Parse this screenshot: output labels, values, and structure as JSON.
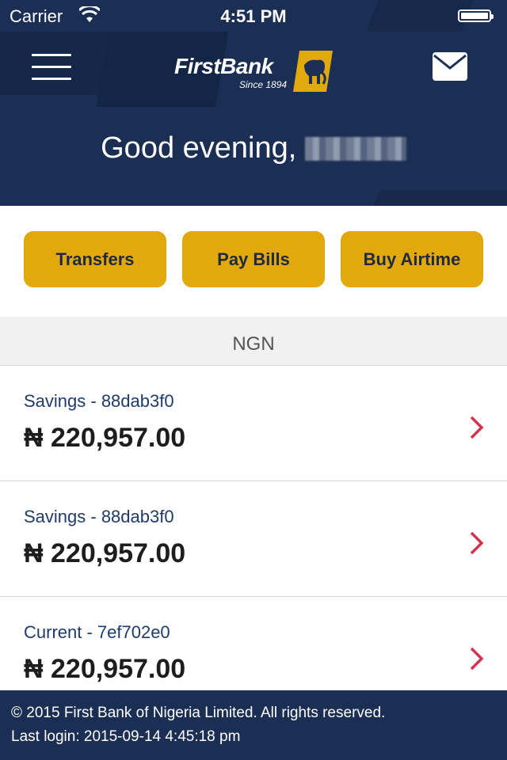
{
  "status_bar": {
    "carrier": "Carrier",
    "time": "4:51 PM",
    "wifi_icon": "wifi-icon",
    "battery_level": 1.0
  },
  "header": {
    "menu_icon": "hamburger-menu-icon",
    "logo": {
      "name": "FirstBank",
      "since": "Since 1894",
      "mark_icon": "elephant-logo-icon"
    },
    "mail_icon": "envelope-icon",
    "greeting": "Good evening,",
    "background_color": "#1b2f54"
  },
  "actions": [
    {
      "label": "Transfers"
    },
    {
      "label": "Pay Bills"
    },
    {
      "label": "Buy Airtime"
    }
  ],
  "currency": "NGN",
  "accounts": [
    {
      "label": "Savings - 88dab3f0",
      "balance": "₦ 220,957.00"
    },
    {
      "label": "Savings - 88dab3f0",
      "balance": "₦ 220,957.00"
    },
    {
      "label": "Current - 7ef702e0",
      "balance": "₦ 220,957.00"
    }
  ],
  "footer": {
    "copyright": "© 2015 First Bank of Nigeria Limited. All rights reserved.",
    "last_login": "Last login: 2015-09-14 4:45:18 pm"
  },
  "colors": {
    "brand_navy": "#1b2f54",
    "action_gold": "#e2a90e",
    "chevron_red": "#d2344f",
    "account_label": "#1f3a6b"
  }
}
